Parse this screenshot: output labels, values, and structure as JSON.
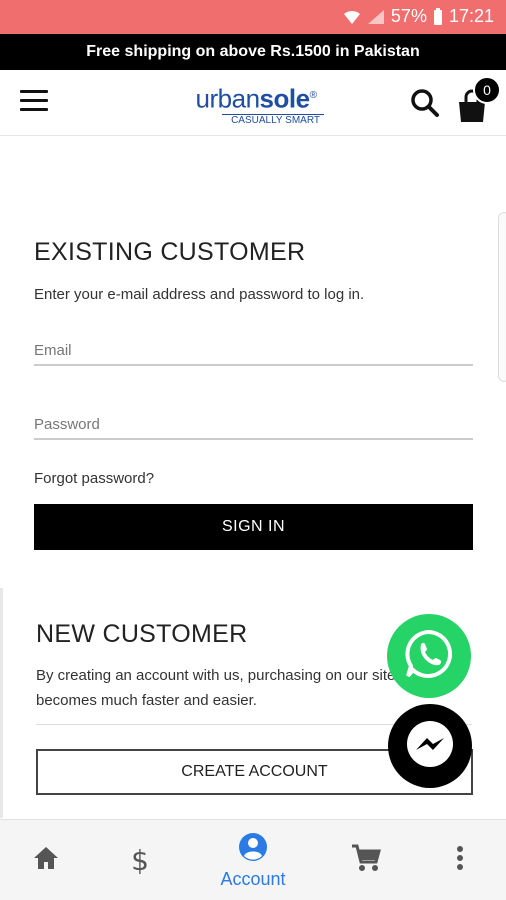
{
  "status_bar": {
    "battery": "57%",
    "time": "17:21"
  },
  "promo": {
    "text": "Free shipping on above Rs.1500 in Pakistan"
  },
  "header": {
    "logo_part1": "urban",
    "logo_part2": "sole",
    "logo_reg": "®",
    "logo_tagline": "CASUALLY SMART",
    "cart_count": "0"
  },
  "existing_customer": {
    "title": "EXISTING CUSTOMER",
    "description": "Enter your e-mail address and password to log in.",
    "email_placeholder": "Email",
    "password_placeholder": "Password",
    "forgot_label": "Forgot password?",
    "signin_label": "SIGN IN"
  },
  "new_customer": {
    "title": "NEW CUSTOMER",
    "description_line1": "By creating an account with us, purchasing on our site",
    "description_line2": "becomes much faster and easier.",
    "create_label": "CREATE ACCOUNT"
  },
  "fabs": {
    "whatsapp_icon": "whatsapp-icon",
    "messenger_icon": "messenger-icon"
  },
  "bottom_nav": {
    "items": [
      {
        "icon": "home-icon",
        "label": ""
      },
      {
        "icon": "dollar-icon",
        "label": "$"
      },
      {
        "icon": "account-icon",
        "label": "Account"
      },
      {
        "icon": "cart-icon",
        "label": ""
      },
      {
        "icon": "more-icon",
        "label": ""
      }
    ]
  },
  "colors": {
    "status_bar": "#f06e6e",
    "brand_blue": "#1f4ea3",
    "active_nav": "#2a7be4",
    "whatsapp": "#25d366"
  }
}
